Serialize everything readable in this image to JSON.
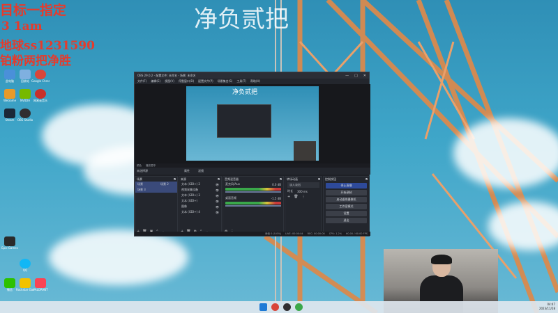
{
  "overlay": {
    "line1": "目标一指定",
    "line2": "3 1am",
    "line3": "地球ss1231590",
    "line4": "铂粉两把净胜",
    "center_title": "净负贰把"
  },
  "desktop_icons": [
    {
      "label": "此电脑",
      "color": "#4a90d9"
    },
    {
      "label": "回收站",
      "color": "#7fb0e0"
    },
    {
      "label": "Google Chrome",
      "color": "#d9463a"
    },
    {
      "label": "WeGame",
      "color": "#e89a2a"
    },
    {
      "label": "NVIDIA",
      "color": "#76b900"
    },
    {
      "label": "网易云音乐",
      "color": "#c8302a"
    },
    {
      "label": "Steam",
      "color": "#1b2838"
    },
    {
      "label": "OBS Studio",
      "color": "#302e31"
    },
    {
      "label": "Epic Games",
      "color": "#2a2a2a"
    },
    {
      "label": "微信",
      "color": "#2dc100"
    },
    {
      "label": "QQ",
      "color": "#12b7f5"
    },
    {
      "label": "Rockstar Games",
      "color": "#f2c200"
    },
    {
      "label": "VALORANT",
      "color": "#fa4454"
    }
  ],
  "obs": {
    "title": "OBS 29.0.2 - 配置文件: 未命名 - 场景: 未命名",
    "menu": [
      "文件(F)",
      "编辑(E)",
      "视图(V)",
      "停靠窗口(D)",
      "配置文件(P)",
      "场景集合(S)",
      "工具(T)",
      "帮助(H)"
    ],
    "preview_overlay": "净负贰把",
    "context_label": "未选择源",
    "context_bar": [
      "颜色",
      "播放暂停"
    ],
    "source_tabs": [
      "属性",
      "滤镜"
    ],
    "docks": {
      "scenes": {
        "title": "场景",
        "items": [
          "场景",
          "场景 2",
          "场景 3"
        ]
      },
      "sources": {
        "title": "来源",
        "items": [
          "文本 (GDI+) 2",
          "视频采集设备",
          "文本 (GDI+) 3",
          "文本 (GDI+)",
          "图像",
          "文本 (GDI+) 4"
        ]
      },
      "mixer": {
        "title": "音频混音器",
        "channels": [
          {
            "name": "麦克风/Aux",
            "level": "0.0 dB"
          },
          {
            "name": "桌面音频",
            "level": "-1.5 dB"
          }
        ]
      },
      "transitions": {
        "title": "转场动画",
        "type": "淡入淡出",
        "duration_label": "时长",
        "duration": "300 ms"
      },
      "controls": {
        "title": "控制按钮",
        "buttons": [
          "停止直播",
          "开始录制",
          "启动虚拟摄像机",
          "工作室模式",
          "设置",
          "退出"
        ]
      }
    },
    "status": {
      "dropped": "丢帧 0 (0.0%)",
      "live": "LIVE: 00:00:04",
      "rec": "REC: 00:00:00",
      "cpu": "CPU: 1.2%",
      "fps": "60.00 / 60.00 FPS"
    }
  },
  "taskbar": {
    "time": "04:47",
    "date": "2023/11/28"
  }
}
